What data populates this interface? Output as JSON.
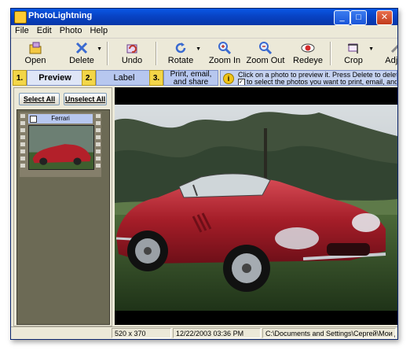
{
  "window": {
    "title": "PhotoLightning",
    "minimize_icon": "minimize-icon",
    "maximize_icon": "maximize-icon",
    "close_icon": "close-icon"
  },
  "menu": [
    "File",
    "Edit",
    "Photo",
    "Help"
  ],
  "toolbar": {
    "open": "Open",
    "delete": "Delete",
    "undo": "Undo",
    "rotate": "Rotate",
    "zoom_in": "Zoom In",
    "zoom_out": "Zoom Out",
    "redeye": "Redeye",
    "crop": "Crop",
    "adjust": "Adjus"
  },
  "steps": [
    {
      "num": "1.",
      "label": "Preview"
    },
    {
      "num": "2.",
      "label": "Label"
    },
    {
      "num": "3.",
      "label": "Print, email, and share"
    }
  ],
  "hint": {
    "line1": "Click on a photo to preview it.  Press Delete to delete a",
    "line2": "to select the photos you want to print, email, and sh"
  },
  "buttons": {
    "select_all": "Select All",
    "unselect_all": "Unselect All"
  },
  "thumbnail": {
    "caption": "Ferrari"
  },
  "status": {
    "size": "520 x 370",
    "date": "12/22/2003  03:36 PM",
    "path": "C:\\Documents and Settings\\Сергей\\Мои д"
  },
  "colors": {
    "title_bar": "#0843c4",
    "step_active": "#f3d648",
    "thumb_pane": "#6c6a55",
    "car_red": "#b3202a"
  }
}
